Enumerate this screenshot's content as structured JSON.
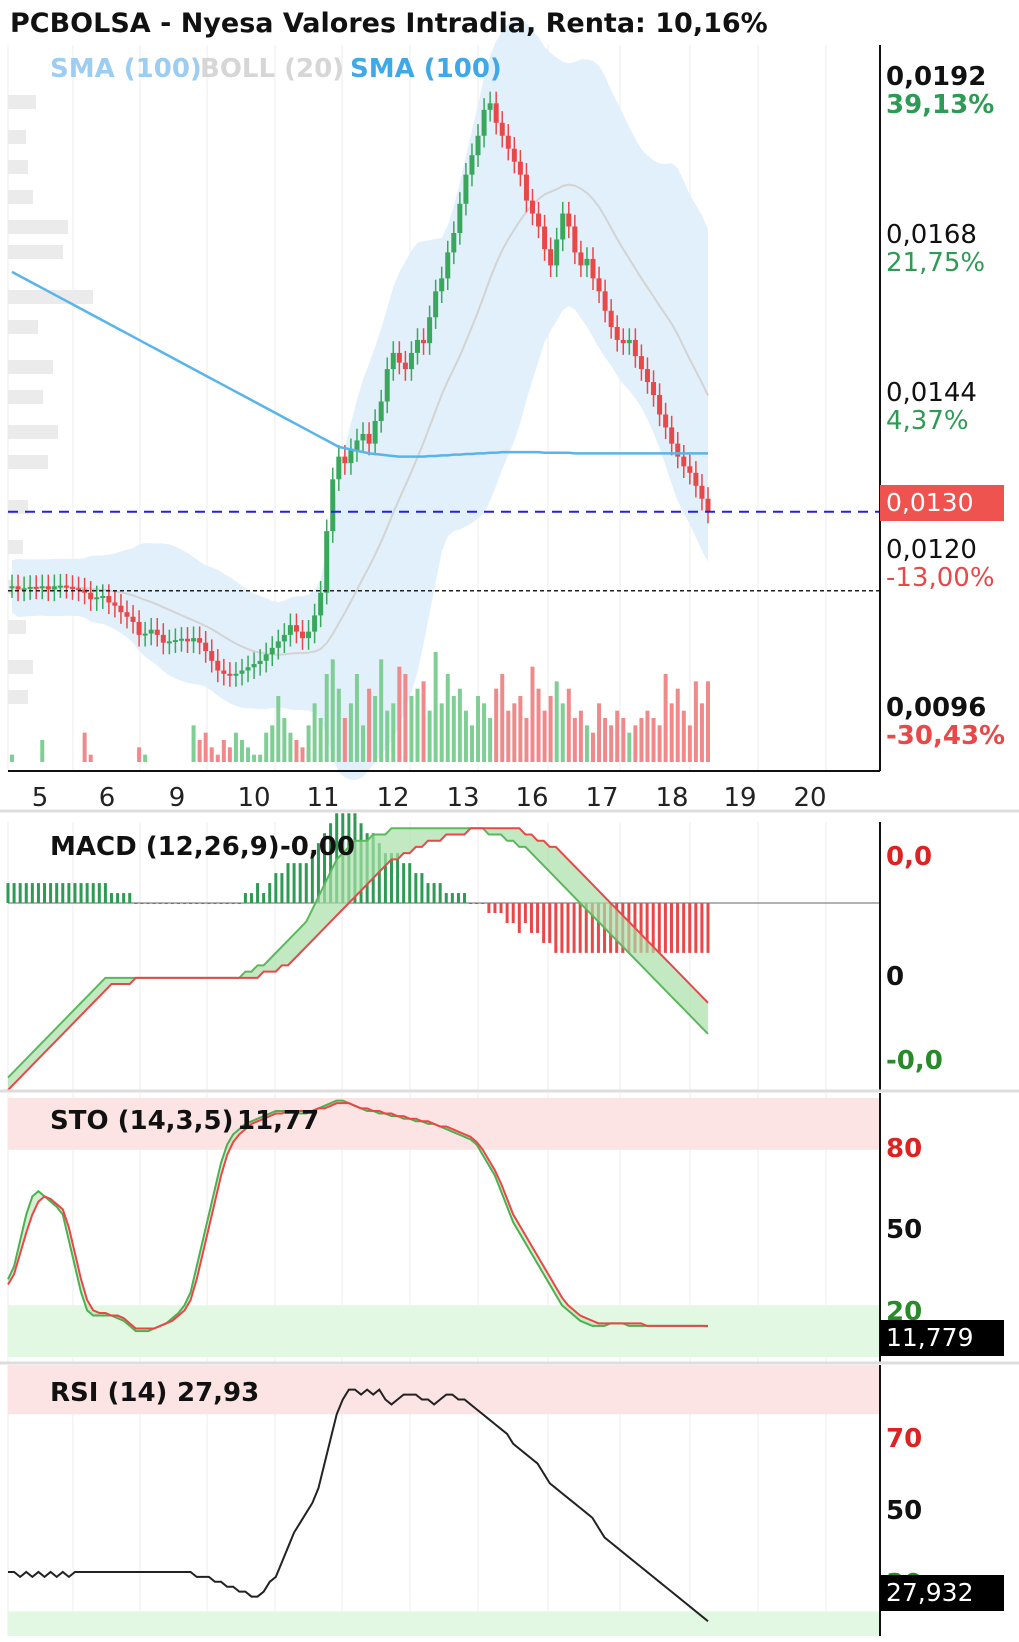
{
  "title": "PCBOLSA - Nyesa Valores Intradia, Renta: 10,16%",
  "legend": [
    {
      "label": "SMA (100)",
      "color": "#9dcdf0"
    },
    {
      "label": "BOLL (20)",
      "color": "#d6d6d6"
    },
    {
      "label": "SMA (100)",
      "color": "#3fa9e8"
    }
  ],
  "colors": {
    "up": "#3aa85c",
    "down": "#e84848",
    "sma": "#58b4ea",
    "band": "#e2f0fb",
    "boll_mid": "#d3d3d3",
    "last_price": "#2222dd",
    "ref_line": "#222222",
    "panel_line": "#cccccc",
    "macd_green": "#5cb85c",
    "macd_red": "#e84848",
    "ob_zone": "#fde4e4",
    "os_zone": "#e3f8e3"
  },
  "price_axis": [
    {
      "price": "0,0192",
      "pct": "39,13%",
      "bold": true
    },
    {
      "price": "0,0168",
      "pct": "21,75%",
      "bold": false
    },
    {
      "price": "0,0144",
      "pct": "4,37%",
      "bold": false
    },
    {
      "price": "0,0120",
      "pct": "-13,00%",
      "bold": false
    },
    {
      "price": "0,0096",
      "pct": "-30,43%",
      "bold": true
    }
  ],
  "last_price_tag": "0,0130",
  "x_axis": [
    "5",
    "6",
    "9",
    "10",
    "11",
    "12",
    "13",
    "16",
    "17",
    "18",
    "19",
    "20"
  ],
  "macd": {
    "title": "MACD (12,26,9)",
    "value": "-0,00",
    "axis": [
      "0,0",
      "0",
      "-0,0"
    ]
  },
  "sto": {
    "title": "STO (14,3,5)",
    "value": "11,77",
    "axis": [
      "80",
      "50",
      "20"
    ],
    "tag": "11,779"
  },
  "rsi": {
    "title": "RSI (14)",
    "value": "27,93",
    "axis": [
      "70",
      "50",
      "30"
    ],
    "tag": "27,932"
  },
  "chart_data": [
    {
      "type": "candlestick",
      "title": "PCBOLSA - Nyesa Valores Intradia, Renta: 10,16%",
      "x_labels": [
        "5",
        "6",
        "9",
        "10",
        "11",
        "12",
        "13",
        "16",
        "17",
        "18",
        "19",
        "20"
      ],
      "ylim": [
        0.009,
        0.0202
      ],
      "reference_price": 0.01178,
      "last_price": 0.013,
      "close_series": [
        0.01185,
        0.0118,
        0.01182,
        0.01184,
        0.01183,
        0.01185,
        0.0118,
        0.01185,
        0.01186,
        0.01184,
        0.01182,
        0.0118,
        0.01175,
        0.01165,
        0.01168,
        0.0117,
        0.0116,
        0.01155,
        0.01145,
        0.01138,
        0.0113,
        0.0111,
        0.01112,
        0.01118,
        0.0111,
        0.01098,
        0.011,
        0.01102,
        0.01104,
        0.011,
        0.01105,
        0.01098,
        0.01085,
        0.0107,
        0.01055,
        0.0105,
        0.01048,
        0.0105,
        0.01055,
        0.0106,
        0.01065,
        0.0107,
        0.0108,
        0.0109,
        0.011,
        0.0111,
        0.01125,
        0.01115,
        0.01105,
        0.01115,
        0.0114,
        0.01175,
        0.0127,
        0.0135,
        0.01385,
        0.01375,
        0.01395,
        0.0141,
        0.0142,
        0.01405,
        0.0144,
        0.0147,
        0.0152,
        0.01545,
        0.0153,
        0.0152,
        0.01545,
        0.01565,
        0.0156,
        0.016,
        0.0164,
        0.0166,
        0.017,
        0.0173,
        0.01775,
        0.0182,
        0.0185,
        0.0188,
        0.0192,
        0.0193,
        0.019,
        0.0188,
        0.0186,
        0.0184,
        0.0182,
        0.0178,
        0.0176,
        0.0174,
        0.01705,
        0.0168,
        0.0172,
        0.0176,
        0.0174,
        0.017,
        0.0168,
        0.0169,
        0.0166,
        0.0164,
        0.0161,
        0.01585,
        0.01565,
        0.0156,
        0.01565,
        0.0154,
        0.0152,
        0.015,
        0.0148,
        0.0145,
        0.0143,
        0.01405,
        0.01385,
        0.0137,
        0.0136,
        0.0134,
        0.0132,
        0.013
      ],
      "volume_series": [
        1,
        0,
        0,
        0,
        0,
        3,
        0,
        0,
        0,
        0,
        0,
        0,
        4,
        1,
        0,
        0,
        0,
        0,
        0,
        0,
        0,
        2,
        1,
        0,
        0,
        0,
        0,
        0,
        0,
        0,
        5,
        3,
        4,
        2,
        1,
        3,
        2,
        4,
        3,
        2,
        1,
        1,
        4,
        5,
        9,
        6,
        4,
        3,
        2,
        5,
        8,
        6,
        12,
        14,
        10,
        6,
        8,
        12,
        5,
        10,
        9,
        14,
        7,
        8,
        13,
        12,
        9,
        10,
        11,
        7,
        15,
        8,
        12,
        9,
        10,
        7,
        5,
        9,
        8,
        6,
        10,
        12,
        7,
        8,
        9,
        6,
        13,
        10,
        7,
        9,
        11,
        8,
        10,
        6,
        7,
        5,
        4,
        8,
        6,
        5,
        7,
        6,
        4,
        5,
        6,
        7,
        6,
        5,
        12,
        8,
        10,
        7,
        5,
        11,
        8,
        11
      ],
      "sma100": [
        0.0167,
        0.01665,
        0.0166,
        0.01655,
        0.0165,
        0.01645,
        0.0164,
        0.01635,
        0.0163,
        0.01625,
        0.0162,
        0.01615,
        0.0161,
        0.01605,
        0.016,
        0.01595,
        0.0159,
        0.01585,
        0.0158,
        0.01575,
        0.0157,
        0.01565,
        0.0156,
        0.01555,
        0.0155,
        0.01545,
        0.0154,
        0.01535,
        0.0153,
        0.01525,
        0.0152,
        0.01515,
        0.0151,
        0.01505,
        0.015,
        0.01495,
        0.0149,
        0.01485,
        0.0148,
        0.01475,
        0.0147,
        0.01465,
        0.0146,
        0.01455,
        0.0145,
        0.01445,
        0.0144,
        0.01435,
        0.0143,
        0.01425,
        0.0142,
        0.01415,
        0.0141,
        0.01405,
        0.014,
        0.01398,
        0.01396,
        0.01394,
        0.01392,
        0.0139,
        0.01389,
        0.01388,
        0.01387,
        0.01386,
        0.01385,
        0.01385,
        0.01385,
        0.01385,
        0.01385,
        0.01386,
        0.01386,
        0.01387,
        0.01387,
        0.01388,
        0.01388,
        0.01389,
        0.01389,
        0.0139,
        0.0139,
        0.01391,
        0.01391,
        0.01392,
        0.01392,
        0.01392,
        0.01392,
        0.01392,
        0.01392,
        0.01392,
        0.01391,
        0.01391,
        0.01391,
        0.01391,
        0.01391,
        0.0139,
        0.0139,
        0.0139,
        0.0139,
        0.0139,
        0.0139,
        0.0139,
        0.0139,
        0.0139,
        0.0139,
        0.0139,
        0.0139,
        0.0139,
        0.0139,
        0.0139,
        0.0139,
        0.0139,
        0.0139,
        0.0139,
        0.0139,
        0.0139,
        0.0139,
        0.0139
      ]
    },
    {
      "type": "area",
      "title": "MACD (12,26,9)",
      "ylim": [
        -0.0003,
        0.00013
      ],
      "macd": [
        -0.00028,
        -0.00027,
        -0.00026,
        -0.00025,
        -0.00024,
        -0.00023,
        -0.00022,
        -0.00021,
        -0.0002,
        -0.00019,
        -0.00018,
        -0.00017,
        -0.00016,
        -0.00015,
        -0.00014,
        -0.00013,
        -0.00012,
        -0.00012,
        -0.00012,
        -0.00012,
        -0.00012,
        -0.00012,
        -0.00012,
        -0.00012,
        -0.00012,
        -0.00012,
        -0.00012,
        -0.00012,
        -0.00012,
        -0.00012,
        -0.00012,
        -0.00012,
        -0.00012,
        -0.00012,
        -0.00012,
        -0.00012,
        -0.00012,
        -0.00012,
        -0.00012,
        -0.00011,
        -0.00011,
        -0.0001,
        -0.0001,
        -9e-05,
        -8e-05,
        -7e-05,
        -6e-05,
        -5e-05,
        -4e-05,
        -3e-05,
        -1e-05,
        1e-05,
        3e-05,
        5e-05,
        7e-05,
        8e-05,
        9e-05,
        0.0001,
        0.0001,
        0.0001,
        0.00011,
        0.00011,
        0.00011,
        0.00012,
        0.00012,
        0.00012,
        0.00012,
        0.00012,
        0.00012,
        0.00012,
        0.00012,
        0.00012,
        0.00012,
        0.00012,
        0.00012,
        0.00012,
        0.00012,
        0.00012,
        0.00012,
        0.00011,
        0.00011,
        0.00011,
        0.0001,
        0.0001,
        9e-05,
        9e-05,
        8e-05,
        7e-05,
        6e-05,
        5e-05,
        4e-05,
        3e-05,
        2e-05,
        1e-05,
        0,
        -1e-05,
        -2e-05,
        -3e-05,
        -4e-05,
        -5e-05,
        -6e-05,
        -7e-05,
        -8e-05,
        -9e-05,
        -0.0001,
        -0.00011,
        -0.00012,
        -0.00013,
        -0.00014,
        -0.00015,
        -0.00016,
        -0.00017,
        -0.00018,
        -0.00019,
        -0.0002,
        -0.00021
      ],
      "signal": [
        -0.0003,
        -0.00029,
        -0.00028,
        -0.00027,
        -0.00026,
        -0.00025,
        -0.00024,
        -0.00023,
        -0.00022,
        -0.00021,
        -0.0002,
        -0.00019,
        -0.00018,
        -0.00017,
        -0.00016,
        -0.00015,
        -0.00014,
        -0.00013,
        -0.00013,
        -0.00013,
        -0.00013,
        -0.00012,
        -0.00012,
        -0.00012,
        -0.00012,
        -0.00012,
        -0.00012,
        -0.00012,
        -0.00012,
        -0.00012,
        -0.00012,
        -0.00012,
        -0.00012,
        -0.00012,
        -0.00012,
        -0.00012,
        -0.00012,
        -0.00012,
        -0.00012,
        -0.00012,
        -0.00012,
        -0.00012,
        -0.00011,
        -0.00011,
        -0.00011,
        -0.0001,
        -0.0001,
        -9e-05,
        -8e-05,
        -7e-05,
        -6e-05,
        -5e-05,
        -4e-05,
        -3e-05,
        -2e-05,
        -1e-05,
        0,
        1e-05,
        2e-05,
        3e-05,
        4e-05,
        5e-05,
        6e-05,
        7e-05,
        7e-05,
        8e-05,
        8e-05,
        9e-05,
        9e-05,
        0.0001,
        0.0001,
        0.0001,
        0.00011,
        0.00011,
        0.00011,
        0.00011,
        0.00012,
        0.00012,
        0.00012,
        0.00012,
        0.00012,
        0.00012,
        0.00012,
        0.00012,
        0.00012,
        0.00011,
        0.00011,
        0.0001,
        0.0001,
        9e-05,
        9e-05,
        8e-05,
        7e-05,
        6e-05,
        5e-05,
        4e-05,
        3e-05,
        2e-05,
        1e-05,
        0,
        -1e-05,
        -2e-05,
        -3e-05,
        -4e-05,
        -5e-05,
        -6e-05,
        -7e-05,
        -8e-05,
        -9e-05,
        -0.0001,
        -0.00011,
        -0.00012,
        -0.00013,
        -0.00014,
        -0.00015,
        -0.00016
      ]
    },
    {
      "type": "line",
      "title": "STO (14,3,5)",
      "ylim": [
        0,
        100
      ],
      "k": [
        30,
        35,
        45,
        55,
        62,
        64,
        62,
        60,
        58,
        55,
        45,
        35,
        25,
        18,
        16,
        16,
        16,
        16,
        15,
        14,
        12,
        10,
        10,
        10,
        11,
        12,
        13,
        15,
        17,
        20,
        25,
        35,
        45,
        55,
        65,
        75,
        82,
        86,
        88,
        90,
        91,
        92,
        93,
        94,
        95,
        95,
        95,
        95,
        94,
        94,
        95,
        96,
        97,
        98,
        99,
        99,
        98,
        97,
        96,
        95,
        95,
        94,
        94,
        93,
        93,
        92,
        92,
        91,
        91,
        90,
        90,
        89,
        88,
        87,
        86,
        85,
        84,
        82,
        78,
        74,
        70,
        64,
        58,
        52,
        48,
        44,
        40,
        36,
        32,
        28,
        24,
        20,
        18,
        16,
        14,
        13,
        12,
        12,
        12,
        13,
        13,
        13,
        12,
        12,
        12,
        12,
        12,
        12,
        12,
        12,
        12,
        12,
        12,
        12,
        12,
        11.8
      ],
      "d": [
        28,
        32,
        40,
        48,
        55,
        60,
        62,
        61,
        59,
        57,
        50,
        40,
        30,
        22,
        18,
        17,
        17,
        16,
        16,
        15,
        13,
        11,
        11,
        11,
        11,
        12,
        13,
        14,
        16,
        18,
        22,
        30,
        40,
        50,
        60,
        70,
        78,
        83,
        86,
        88,
        90,
        91,
        92,
        93,
        94,
        94,
        95,
        95,
        95,
        95,
        95,
        96,
        96,
        97,
        98,
        98,
        98,
        97,
        96,
        96,
        95,
        95,
        94,
        94,
        93,
        93,
        92,
        92,
        91,
        91,
        90,
        89,
        89,
        88,
        87,
        86,
        85,
        83,
        80,
        76,
        72,
        67,
        61,
        55,
        51,
        47,
        43,
        39,
        35,
        31,
        27,
        23,
        20,
        18,
        16,
        15,
        14,
        13,
        13,
        13,
        13,
        13,
        13,
        13,
        13,
        12,
        12,
        12,
        12,
        12,
        12,
        12,
        12,
        12,
        12,
        12
      ]
    },
    {
      "type": "line",
      "title": "RSI (14)",
      "ylim": [
        25,
        80
      ],
      "rsi": [
        38,
        38,
        37,
        38,
        37,
        38,
        37,
        38,
        37,
        38,
        37,
        38,
        38,
        38,
        38,
        38,
        38,
        38,
        38,
        38,
        38,
        38,
        38,
        38,
        38,
        38,
        38,
        38,
        38,
        38,
        38,
        37,
        37,
        37,
        36,
        36,
        35,
        35,
        34,
        34,
        33,
        33,
        34,
        36,
        37,
        40,
        43,
        46,
        48,
        50,
        52,
        55,
        60,
        65,
        70,
        73,
        75,
        75,
        74,
        75,
        74,
        75,
        73,
        72,
        73,
        74,
        74,
        74,
        73,
        73,
        72,
        73,
        74,
        74,
        73,
        73,
        72,
        71,
        70,
        69,
        68,
        67,
        66,
        64,
        63,
        62,
        61,
        60,
        58,
        56,
        55,
        54,
        53,
        52,
        51,
        50,
        49,
        47,
        45,
        44,
        43,
        42,
        41,
        40,
        39,
        38,
        37,
        36,
        35,
        34,
        33,
        32,
        31,
        30,
        29,
        28
      ]
    }
  ]
}
